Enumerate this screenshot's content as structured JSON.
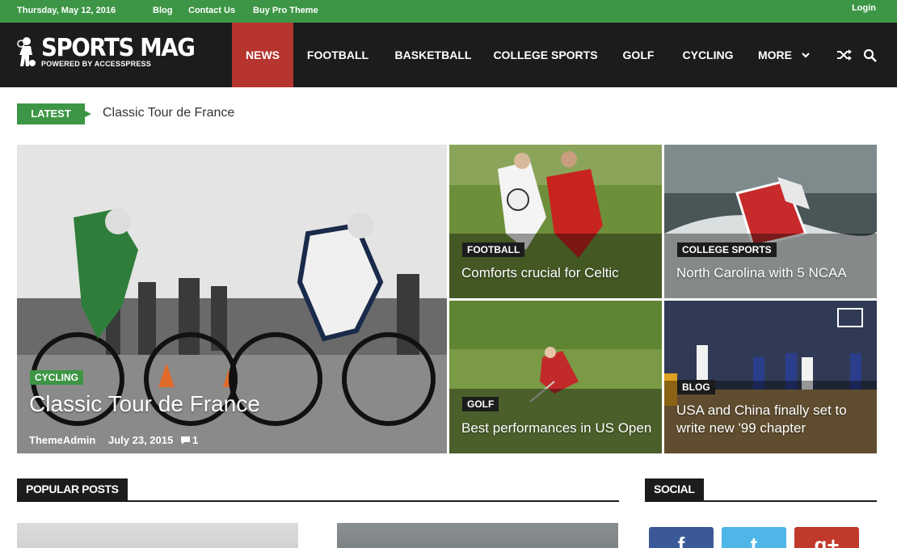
{
  "topbar": {
    "date": "Thursday, May 12, 2016",
    "links": [
      "Blog",
      "Contact Us",
      "Buy Pro Theme"
    ],
    "login": "Login"
  },
  "logo": {
    "title": "SPORTS MAG",
    "subtitle": "POWERED BY ACCESSPRESS"
  },
  "nav": {
    "items": [
      "NEWS",
      "FOOTBALL",
      "BASKETBALL",
      "COLLEGE SPORTS",
      "GOLF",
      "CYCLING",
      "MORE"
    ],
    "active": "NEWS",
    "icons": [
      "chevron-down-icon",
      "shuffle-icon",
      "search-icon"
    ]
  },
  "latest": {
    "tag": "LATEST",
    "headline": "Classic Tour de France"
  },
  "featured": {
    "main": {
      "category": "CYCLING",
      "title": "Classic Tour de France",
      "author": "ThemeAdmin",
      "date": "July 23, 2015",
      "comments": "1"
    },
    "tiles": [
      {
        "category": "FOOTBALL",
        "title": "Comforts crucial for Celtic"
      },
      {
        "category": "COLLEGE SPORTS",
        "title": "North Carolina with 5 NCAA"
      },
      {
        "category": "GOLF",
        "title": "Best performances in US Open"
      },
      {
        "category": "BLOG",
        "title_line1": "USA and China finally set to",
        "title_line2": "write new '99 chapter"
      }
    ]
  },
  "sections": {
    "popular": "POPULAR POSTS",
    "social": "SOCIAL"
  },
  "social": [
    {
      "name": "facebook",
      "glyph": "f"
    },
    {
      "name": "twitter",
      "glyph": "t"
    },
    {
      "name": "google-plus",
      "glyph": "g+"
    }
  ],
  "colors": {
    "green": "#3d9645",
    "red": "#b7352f",
    "dark": "#1c1c1c",
    "facebook": "#3b5998",
    "twitter": "#4fb6e8",
    "google": "#c0392b"
  }
}
